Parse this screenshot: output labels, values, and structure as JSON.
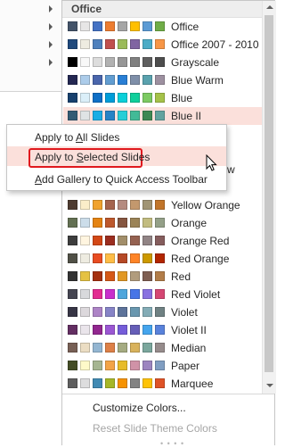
{
  "gallery": {
    "header": "Office",
    "themes": [
      {
        "name": "Office",
        "colors": [
          "#44546a",
          "#e7e6e6",
          "#4472c4",
          "#ed7d31",
          "#a5a5a5",
          "#ffc000",
          "#5b9bd5",
          "#70ad47"
        ]
      },
      {
        "name": "Office 2007 - 2010",
        "colors": [
          "#1f497d",
          "#eeece1",
          "#4f81bd",
          "#c0504d",
          "#9bbb59",
          "#8064a2",
          "#4bacc6",
          "#f79646"
        ]
      },
      {
        "name": "Grayscale",
        "colors": [
          "#000000",
          "#f8f8f8",
          "#dddddd",
          "#b2b2b2",
          "#969696",
          "#808080",
          "#5f5f5f",
          "#4d4d4d"
        ]
      },
      {
        "name": "Blue Warm",
        "colors": [
          "#242852",
          "#acccea",
          "#4a66ac",
          "#629dd1",
          "#297fd5",
          "#7f8fa9",
          "#5aa2ae",
          "#9d90a0"
        ]
      },
      {
        "name": "Blue",
        "colors": [
          "#17406d",
          "#dbeff9",
          "#0f6fc6",
          "#009dd9",
          "#0bd0d9",
          "#10cf9b",
          "#7cca62",
          "#a5c249"
        ]
      },
      {
        "name": "Blue II",
        "colors": [
          "#335b74",
          "#dfe3e5",
          "#1cade4",
          "#2683c6",
          "#27ced7",
          "#42ba97",
          "#3e8853",
          "#62a39f"
        ]
      },
      {
        "name": "",
        "colors": []
      },
      {
        "name": "",
        "colors": []
      },
      {
        "name": "",
        "colors": []
      },
      {
        "name": "",
        "colors": []
      },
      {
        "name": "Yellow Orange",
        "colors": [
          "#4e3b30",
          "#fbeec9",
          "#f0a22e",
          "#a5644e",
          "#b58b80",
          "#c3986d",
          "#a19574",
          "#c17529"
        ]
      },
      {
        "name": "Orange",
        "colors": [
          "#637052",
          "#ccddea",
          "#e48312",
          "#bd582c",
          "#865640",
          "#9b8357",
          "#c2bc80",
          "#94a088"
        ]
      },
      {
        "name": "Orange Red",
        "colors": [
          "#3d3d3d",
          "#fff5e0",
          "#d34817",
          "#9b2d1f",
          "#a28e6a",
          "#956251",
          "#918485",
          "#855d5d"
        ]
      },
      {
        "name": "Red Orange",
        "colors": [
          "#505046",
          "#eeece1",
          "#e84c22",
          "#ffbd47",
          "#b64926",
          "#ff8427",
          "#cc9900",
          "#b22600"
        ]
      },
      {
        "name": "Red",
        "colors": [
          "#323232",
          "#e5c243",
          "#a5300f",
          "#d55816",
          "#e19825",
          "#b19c7d",
          "#7f5f52",
          "#b27d49"
        ]
      },
      {
        "name": "Red Violet",
        "colors": [
          "#454551",
          "#d8d9dc",
          "#e32d91",
          "#c830cc",
          "#4ea6dc",
          "#4775e7",
          "#8971e1",
          "#d54773"
        ]
      },
      {
        "name": "Violet",
        "colors": [
          "#373545",
          "#dcd8dc",
          "#ad84c6",
          "#8784c7",
          "#5d739a",
          "#6997af",
          "#84acb6",
          "#6f8183"
        ]
      },
      {
        "name": "Violet II",
        "colors": [
          "#632e62",
          "#eae5eb",
          "#92278f",
          "#9b57d3",
          "#755dd9",
          "#665eb8",
          "#45a5ed",
          "#5982db"
        ]
      },
      {
        "name": "Median",
        "colors": [
          "#775f55",
          "#ebddc3",
          "#94b6d2",
          "#dd8047",
          "#a5ab81",
          "#d8b25c",
          "#7ba79d",
          "#968c8c"
        ]
      },
      {
        "name": "Paper",
        "colors": [
          "#444d26",
          "#fefac9",
          "#a5b592",
          "#f3a447",
          "#e7bc29",
          "#d092a7",
          "#9c85c0",
          "#809ec2"
        ]
      },
      {
        "name": "Marquee",
        "colors": [
          "#5e5e5e",
          "#ddddde",
          "#418ab3",
          "#a6b727",
          "#f69200",
          "#838383",
          "#fec306",
          "#df5327"
        ]
      }
    ],
    "footer": {
      "customize": "Customize Colors...",
      "reset": "Reset Slide Theme Colors"
    }
  },
  "context_menu": {
    "items": [
      {
        "label": "Apply to All Slides"
      },
      {
        "label": "Apply to Selected Slides"
      },
      {
        "label": "Add Gallery to Quick Access Toolbar"
      }
    ]
  },
  "partial_label": "w",
  "colors": {
    "highlight_border": "#e0191e",
    "hover_fill": "#fbe0db"
  }
}
